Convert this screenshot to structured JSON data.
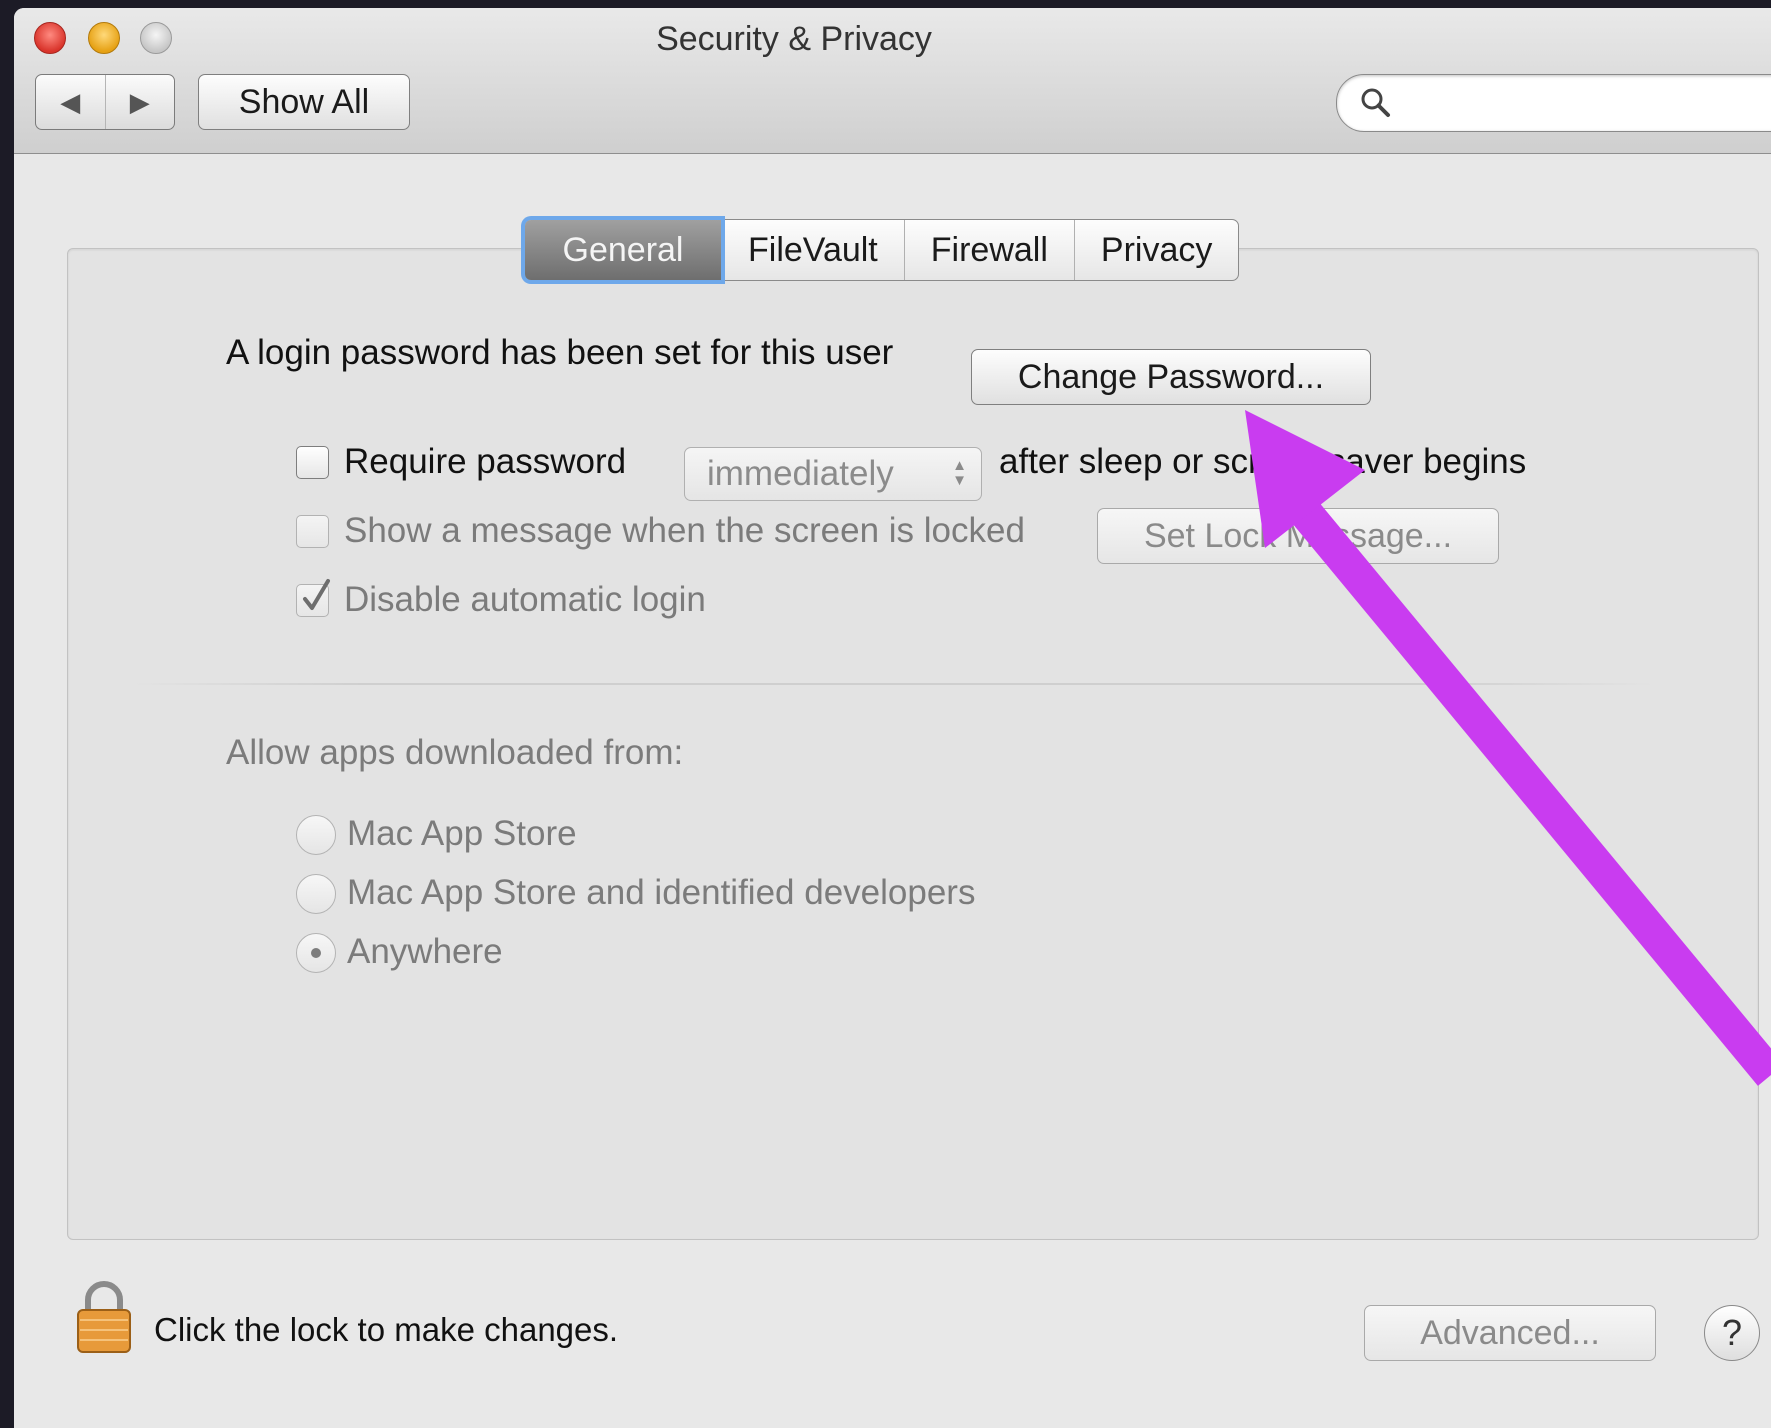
{
  "window": {
    "title": "Security & Privacy"
  },
  "toolbar": {
    "back_glyph": "◀",
    "forward_glyph": "▶",
    "show_all_label": "Show All",
    "search_placeholder": ""
  },
  "tabs": [
    {
      "label": "General",
      "active": true
    },
    {
      "label": "FileVault",
      "active": false
    },
    {
      "label": "Firewall",
      "active": false
    },
    {
      "label": "Privacy",
      "active": false
    }
  ],
  "general": {
    "login_password_text": "A login password has been set for this user",
    "change_password_label": "Change Password...",
    "require_password": {
      "label": "Require password",
      "checked": false,
      "delay_value": "immediately",
      "suffix": "after sleep or screen saver begins"
    },
    "show_message": {
      "label": "Show a message when the screen is locked",
      "checked": false,
      "enabled": false,
      "button_label": "Set Lock Message..."
    },
    "disable_auto_login": {
      "label": "Disable automatic login",
      "checked": true,
      "enabled": false
    },
    "allow_apps": {
      "heading": "Allow apps downloaded from:",
      "options": [
        {
          "label": "Mac App Store",
          "selected": false
        },
        {
          "label": "Mac App Store and identified developers",
          "selected": false
        },
        {
          "label": "Anywhere",
          "selected": true
        }
      ]
    }
  },
  "footer": {
    "lock_text": "Click the lock to make changes.",
    "advanced_label": "Advanced...",
    "help_glyph": "?"
  },
  "annotation": {
    "arrow_color": "#c93cf0"
  }
}
